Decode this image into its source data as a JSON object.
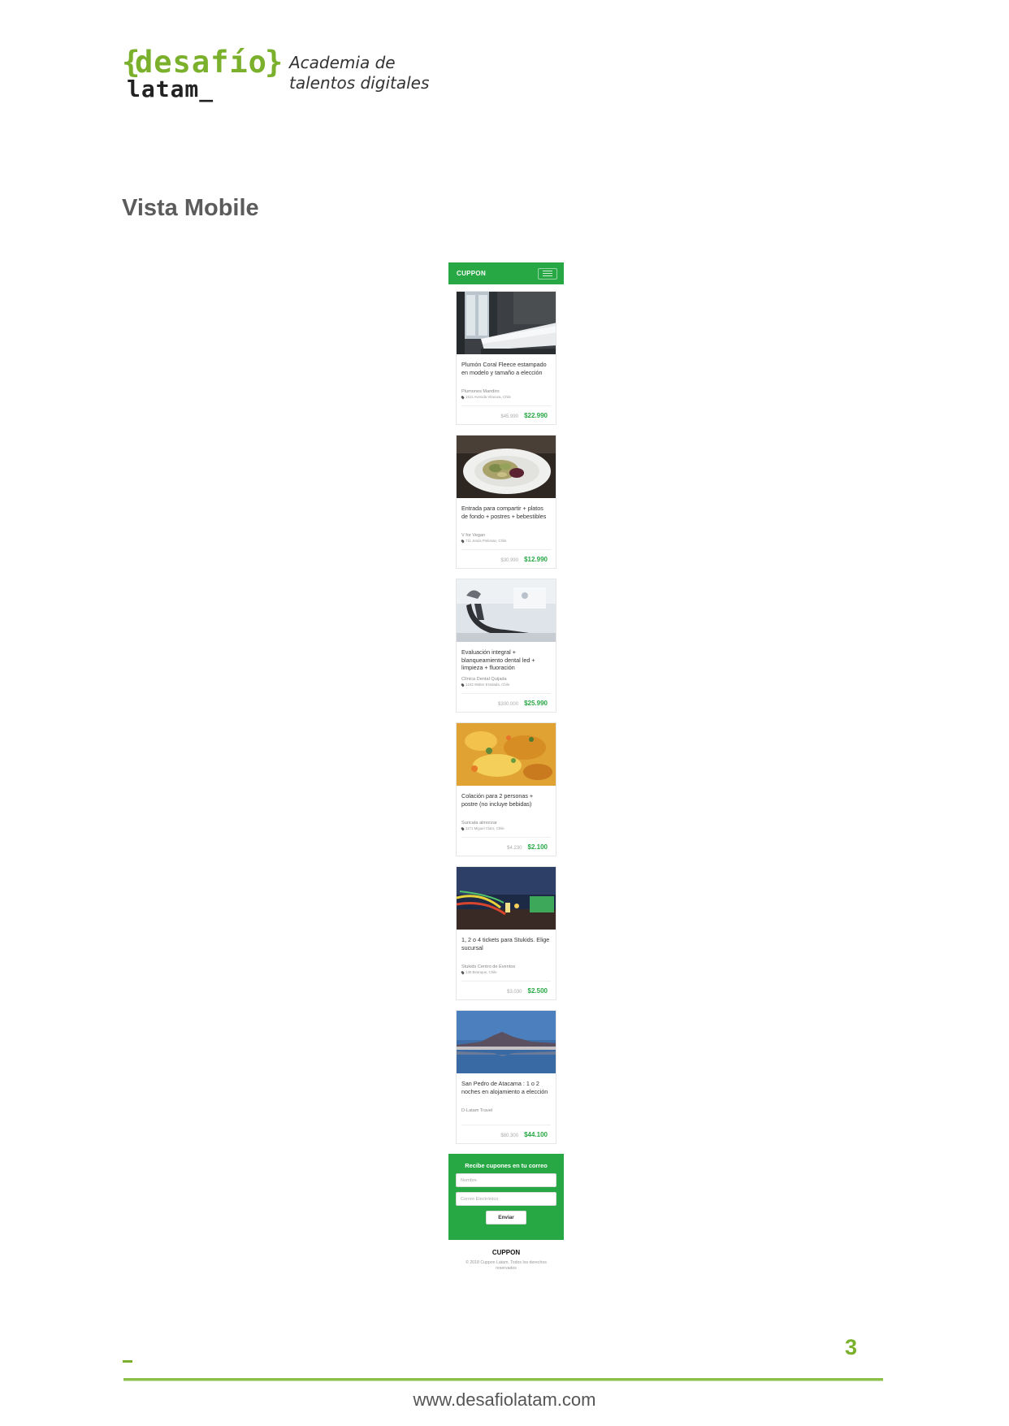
{
  "header": {
    "logo_word": "desafío",
    "logo_brace_left": "{",
    "logo_brace_right": "}",
    "logo_sub": "latam_",
    "tagline_1": "Academia de",
    "tagline_2": "talentos digitales"
  },
  "section_title": "Vista Mobile",
  "phone": {
    "brand": "CUPPON",
    "cards": [
      {
        "title": "Plumón Coral Fleece estampado en modelo y tamaño a elección",
        "shop": "Plumones Mandiro",
        "address": "1511 Avenida Vitacura, Chile",
        "old_price": "$45.990",
        "new_price": "$22.990",
        "image": "bedroom"
      },
      {
        "title": "Entrada para compartir + platos de fondo + postres + bebestibles",
        "shop": "V for Vegan",
        "address": "711 Jesús Pinkman, Chile",
        "old_price": "$30.990",
        "new_price": "$12.990",
        "image": "salad"
      },
      {
        "title": "Evaluación integral + blanqueamiento dental led + limpieza + fluoración",
        "shop": "Clínica Dental Quijada",
        "address": "1242 Walter Estalada, Chile",
        "old_price": "$300.000",
        "new_price": "$25.990",
        "image": "dental"
      },
      {
        "title": "Colación para 2 personas + postre (no incluye bebidas)",
        "shop": "Suricata almorzar",
        "address": "1171 Miguel Claro, Chile",
        "old_price": "$4.230",
        "new_price": "$2.100",
        "image": "food"
      },
      {
        "title": "1, 2 o 4 tickets para Stukids. Elige sucursal",
        "shop": "Stukids Centro de Eventos",
        "address": "130 Biranque, Chile",
        "old_price": "$3.030",
        "new_price": "$2.500",
        "image": "fair"
      },
      {
        "title": "San Pedro de Atacama : 1 o 2 noches en alojamiento a elección",
        "shop": "D-Latam Travel",
        "address": "",
        "old_price": "$80.300",
        "new_price": "$44.100",
        "image": "lake"
      }
    ],
    "newsletter": {
      "title": "Recibe cupones en tu correo",
      "name_placeholder": "Nombre",
      "email_placeholder": "Correo Electrónico",
      "submit_label": "Enviar"
    },
    "footer_brand": "CUPPON",
    "footer_copy": "© 2018 Cuppon Latam. Todos los derechos reservados"
  },
  "page_footer": {
    "page_number": "3",
    "dash": "_",
    "website": "www.desafiolatam.com"
  },
  "colors": {
    "brand_green": "#27a844",
    "logo_green": "#7ab02b"
  }
}
